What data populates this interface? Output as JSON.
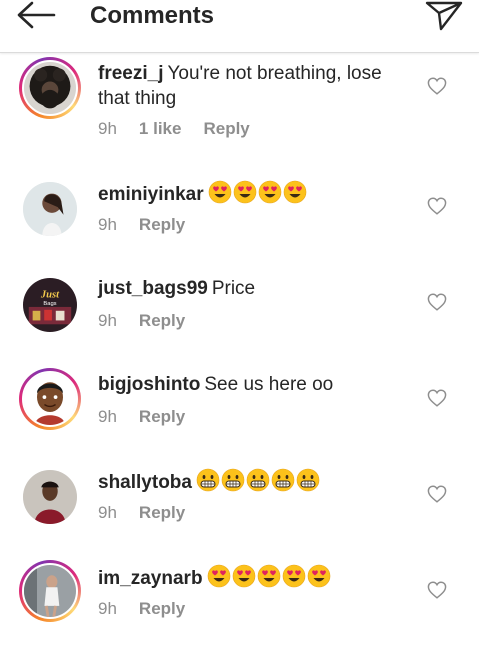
{
  "header": {
    "title": "Comments",
    "back_icon": "back-arrow-icon",
    "send_icon": "send-icon"
  },
  "colors": {
    "meta_text": "#8e8e8e",
    "text": "#262626",
    "divider": "#dbdbdb"
  },
  "comments": [
    {
      "username": "freezi_j",
      "text": "You're not breathing, lose that thing",
      "time": "9h",
      "likes": "1 like",
      "reply": "Reply",
      "emoji": []
    },
    {
      "username": "eminiyinkar",
      "text": "",
      "time": "9h",
      "likes": "",
      "reply": "Reply",
      "emoji": [
        "heart-eyes",
        "heart-eyes",
        "heart-eyes",
        "heart-eyes"
      ]
    },
    {
      "username": "just_bags99",
      "text": "Price",
      "time": "9h",
      "likes": "",
      "reply": "Reply",
      "emoji": []
    },
    {
      "username": "bigjoshinto",
      "text": "See us here oo",
      "time": "9h",
      "likes": "",
      "reply": "Reply",
      "emoji": []
    },
    {
      "username": "shallytoba",
      "text": "",
      "time": "9h",
      "likes": "",
      "reply": "Reply",
      "emoji": [
        "grin",
        "grin",
        "grin",
        "grin",
        "grin"
      ]
    },
    {
      "username": "im_zaynarb",
      "text": "",
      "time": "9h",
      "likes": "",
      "reply": "Reply",
      "emoji": [
        "heart-eyes",
        "heart-eyes",
        "heart-eyes",
        "heart-eyes",
        "heart-eyes"
      ]
    }
  ]
}
